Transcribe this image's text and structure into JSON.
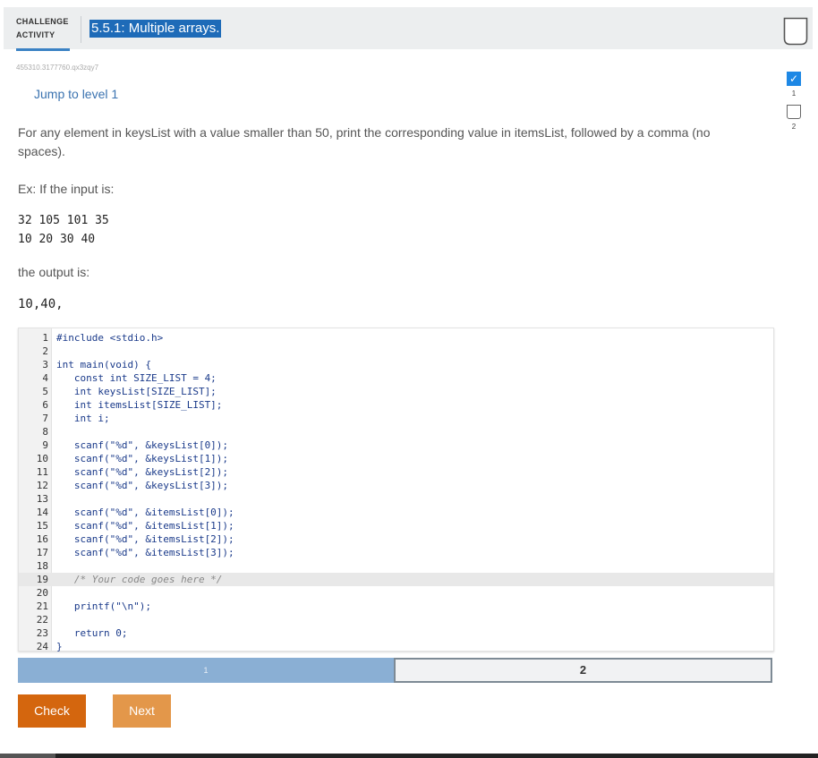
{
  "header": {
    "label_line1": "CHALLENGE",
    "label_line2": "ACTIVITY",
    "title": "5.5.1: Multiple arrays."
  },
  "question_id": "455310.3177760.qx3zqy7",
  "jump_link": "Jump to level 1",
  "levels": [
    {
      "number": "1",
      "status": "completed"
    },
    {
      "number": "2",
      "status": "open"
    }
  ],
  "prompt": "For any element in keysList with a value smaller than 50, print the corresponding value in itemsList, followed by a comma (no spaces).",
  "example": {
    "intro": "Ex: If the input is:",
    "input_line1": "32 105 101 35",
    "input_line2": "10 20 30 40",
    "output_label": "the output is:",
    "output_value": "10,40,"
  },
  "code_lines": [
    "#include <stdio.h>",
    "",
    "int main(void) {",
    "   const int SIZE_LIST = 4;",
    "   int keysList[SIZE_LIST];",
    "   int itemsList[SIZE_LIST];",
    "   int i;",
    "",
    "   scanf(\"%d\", &keysList[0]);",
    "   scanf(\"%d\", &keysList[1]);",
    "   scanf(\"%d\", &keysList[2]);",
    "   scanf(\"%d\", &keysList[3]);",
    "",
    "   scanf(\"%d\", &itemsList[0]);",
    "   scanf(\"%d\", &itemsList[1]);",
    "   scanf(\"%d\", &itemsList[2]);",
    "   scanf(\"%d\", &itemsList[3]);",
    "",
    "   /* Your code goes here */",
    "",
    "   printf(\"\\n\");",
    "",
    "   return 0;",
    "}"
  ],
  "highlighted_line": 19,
  "progress": {
    "segment1_label": "1",
    "segment2_label": "2"
  },
  "buttons": {
    "check": "Check",
    "next": "Next"
  },
  "colors": {
    "accent": "#1e6bb8",
    "check_button": "#d4660e",
    "next_button": "#e3974a",
    "progress_done": "#8aafd4"
  }
}
